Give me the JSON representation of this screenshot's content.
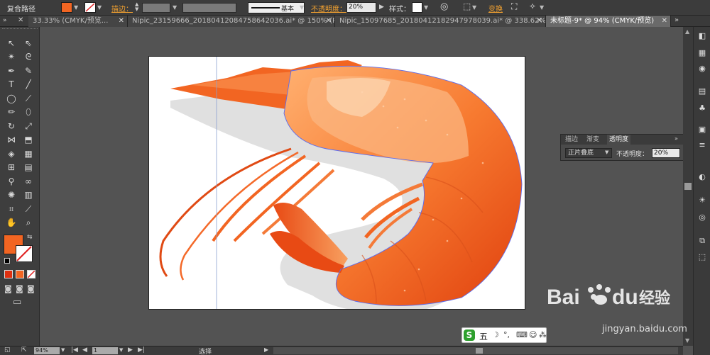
{
  "control_bar": {
    "path_label": "复合路径",
    "stroke_label": "描边：",
    "stroke_style": "基本",
    "opacity_label": "不透明度：",
    "opacity_value": "20%",
    "style_label": "样式：",
    "transform_label": "变换",
    "colors": {
      "fill": "#f26522",
      "accent_label": "#f0a030"
    }
  },
  "tabs": [
    {
      "label": "33.33% (CMYK/预览...",
      "active": false
    },
    {
      "label": "Nipic_23159666_20180412084758642036.ai* @ 150% (R...",
      "active": false
    },
    {
      "label": "Nipic_15097685_20180412182947978039.ai* @ 338.62%...",
      "active": false
    },
    {
      "label": "未标题-9* @ 94% (CMYK/预览)",
      "active": true
    }
  ],
  "tab_overflow": "»",
  "tools": [
    "selection-icon",
    "direct-selection-icon",
    "magic-wand-icon",
    "lasso-icon",
    "pen-icon",
    "curvature-icon",
    "type-icon",
    "line-icon",
    "ellipse-icon",
    "paintbrush-icon",
    "pencil-icon",
    "eraser-icon",
    "rotate-icon",
    "scale-icon",
    "width-icon",
    "free-transform-icon",
    "shape-builder-icon",
    "chart-icon",
    "mesh-icon",
    "gradient-icon",
    "eyedropper-icon",
    "blend-icon",
    "symbol-sprayer-icon",
    "column-graph-icon",
    "artboard-icon",
    "slice-icon",
    "hand-icon",
    "zoom-icon"
  ],
  "transparency_panel": {
    "tabs": [
      "描边",
      "渐变",
      "透明度"
    ],
    "blend_mode": "正片叠底",
    "opacity_label": "不透明度：",
    "opacity_value": "20%"
  },
  "status_bar": {
    "zoom": "94%",
    "page": "1",
    "tool": "选择"
  },
  "ime": {
    "label": "五"
  },
  "watermark": {
    "brand": "Baidu经验",
    "url": "jingyan.baidu.com"
  }
}
